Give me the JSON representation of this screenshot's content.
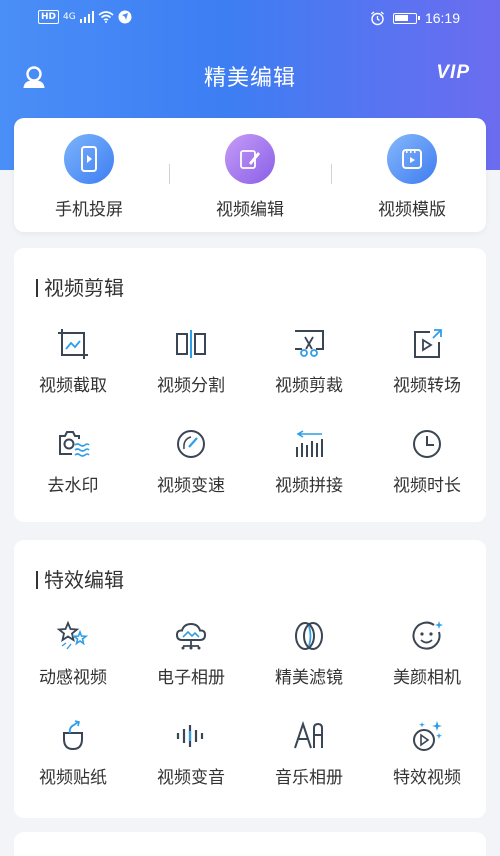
{
  "status_bar": {
    "hd": "HD",
    "network": "4G",
    "time": "16:19"
  },
  "header": {
    "title": "精美编辑",
    "vip": "VIP"
  },
  "quick_actions": [
    {
      "label": "手机投屏",
      "icon": "phone-cast-icon",
      "color": "#4f8ef2"
    },
    {
      "label": "视频编辑",
      "icon": "pencil-icon",
      "color": "#8a5fe8"
    },
    {
      "label": "视频模版",
      "icon": "video-template-icon",
      "color": "#3e7cf0"
    }
  ],
  "sections": [
    {
      "title": "视频剪辑",
      "items": [
        {
          "label": "视频截取",
          "icon": "crop-image-icon"
        },
        {
          "label": "视频分割",
          "icon": "split-icon"
        },
        {
          "label": "视频剪裁",
          "icon": "scissors-icon"
        },
        {
          "label": "视频转场",
          "icon": "transition-icon"
        },
        {
          "label": "去水印",
          "icon": "camera-watermark-icon"
        },
        {
          "label": "视频变速",
          "icon": "speedometer-icon"
        },
        {
          "label": "视频拼接",
          "icon": "join-bars-icon"
        },
        {
          "label": "视频时长",
          "icon": "clock-icon"
        }
      ]
    },
    {
      "title": "特效编辑",
      "items": [
        {
          "label": "动感视频",
          "icon": "stars-icon"
        },
        {
          "label": "电子相册",
          "icon": "cloud-album-icon"
        },
        {
          "label": "精美滤镜",
          "icon": "filter-rings-icon"
        },
        {
          "label": "美颜相机",
          "icon": "smile-face-icon"
        },
        {
          "label": "视频贴纸",
          "icon": "sticker-icon"
        },
        {
          "label": "视频变音",
          "icon": "soundwave-icon"
        },
        {
          "label": "音乐相册",
          "icon": "text-ai-icon"
        },
        {
          "label": "特效视频",
          "icon": "sparkle-play-icon"
        }
      ]
    }
  ],
  "colors": {
    "accent": "#3d7ef3",
    "icon_stroke": "#3b4654",
    "icon_accent": "#2f9ee8"
  }
}
